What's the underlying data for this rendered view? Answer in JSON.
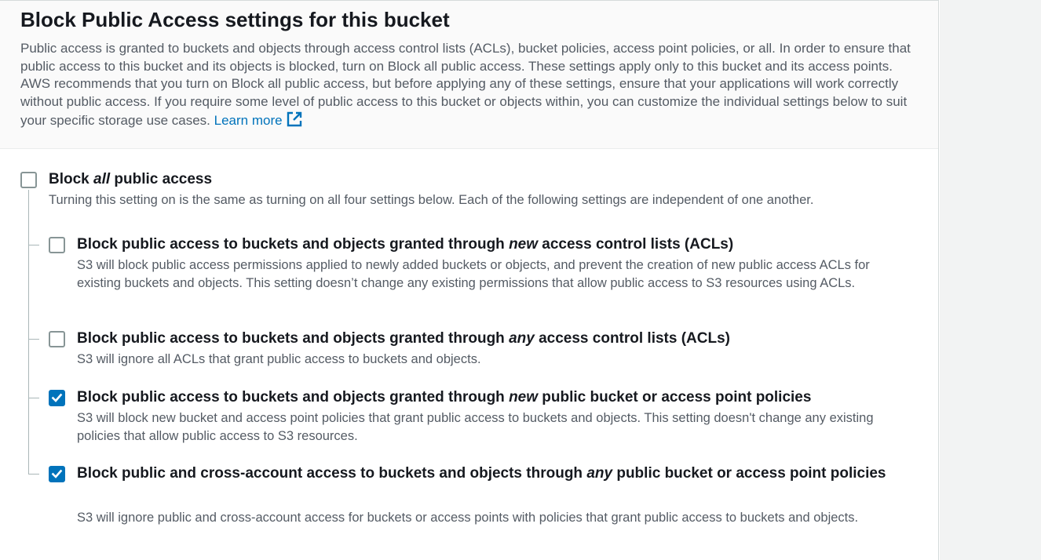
{
  "section": {
    "title": "Block Public Access settings for this bucket",
    "description": "Public access is granted to buckets and objects through access control lists (ACLs), bucket policies, access point policies, or all. In order to ensure that public access to this bucket and its objects is blocked, turn on Block all public access. These settings apply only to this bucket and its access points. AWS recommends that you turn on Block all public access, but before applying any of these settings, ensure that your applications will work correctly without public access. If you require some level of public access to this bucket or objects within, you can customize the individual settings below to suit your specific storage use cases.",
    "learn_more": "Learn more",
    "learn_more_icon": "external-link-icon"
  },
  "block_all": {
    "label_pre": "Block ",
    "label_em": "all",
    "label_post": " public access",
    "help": "Turning this setting on is the same as turning on all four settings below. Each of the following settings are independent of one another.",
    "checked": false
  },
  "settings": [
    {
      "label_pre": "Block public access to buckets and objects granted through ",
      "label_em": "new",
      "label_post": " access control lists (ACLs)",
      "help": "S3 will block public access permissions applied to newly added buckets or objects, and prevent the creation of new public access ACLs for existing buckets and objects. This setting doesn’t change any existing permissions that allow public access to S3 resources using ACLs.",
      "checked": false
    },
    {
      "label_pre": "Block public access to buckets and objects granted through ",
      "label_em": "any",
      "label_post": " access control lists (ACLs)",
      "help": "S3 will ignore all ACLs that grant public access to buckets and objects.",
      "checked": false
    },
    {
      "label_pre": "Block public access to buckets and objects granted through ",
      "label_em": "new",
      "label_post": " public bucket or access point policies",
      "help": "S3 will block new bucket and access point policies that grant public access to buckets and objects. This setting doesn't change any existing policies that allow public access to S3 resources.",
      "checked": true
    },
    {
      "label_pre": "Block public and cross-account access to buckets and objects through ",
      "label_em": "any",
      "label_post": " public bucket or access point policies",
      "help": "S3 will ignore public and cross-account access for buckets or access points with policies that grant public access to buckets and objects.",
      "checked": true
    }
  ],
  "colors": {
    "accent": "#0073bb",
    "text": "#16191f",
    "muted": "#545b64"
  }
}
